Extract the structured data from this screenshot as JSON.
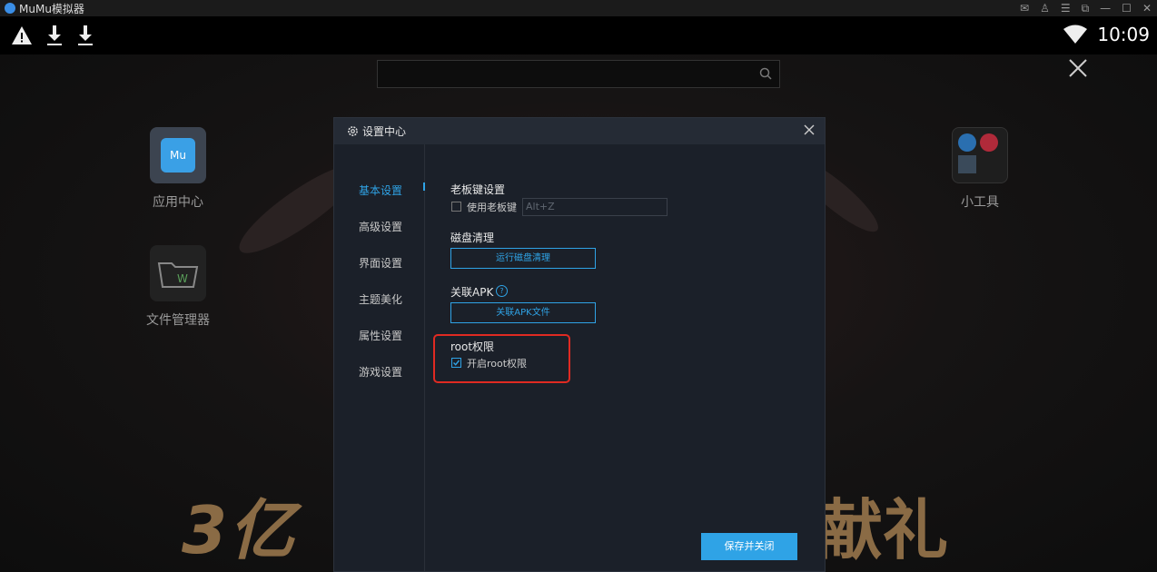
{
  "window": {
    "title": "MuMu模拟器"
  },
  "statusbar": {
    "time": "10:09"
  },
  "desktop": {
    "search_placeholder": "",
    "apps": [
      {
        "label": "应用中心"
      },
      {
        "label": "文件管理器"
      },
      {
        "label": "小工具"
      }
    ],
    "banner_left": "3亿",
    "banner_right": "献礼"
  },
  "dialog": {
    "title": "设置中心",
    "nav": [
      "基本设置",
      "高级设置",
      "界面设置",
      "主题美化",
      "属性设置",
      "游戏设置"
    ],
    "boss_key": {
      "title": "老板键设置",
      "checkbox_label": "使用老板键",
      "hotkey_placeholder": "Alt+Z"
    },
    "disk": {
      "title": "磁盘清理",
      "button": "运行磁盘清理"
    },
    "apk": {
      "title": "关联APK",
      "help": "?",
      "button": "关联APK文件"
    },
    "root": {
      "title": "root权限",
      "checkbox_label": "开启root权限",
      "checked": true
    },
    "save_button": "保存并关闭"
  },
  "colors": {
    "accent": "#2fa3e6",
    "highlight": "#e02a22"
  }
}
